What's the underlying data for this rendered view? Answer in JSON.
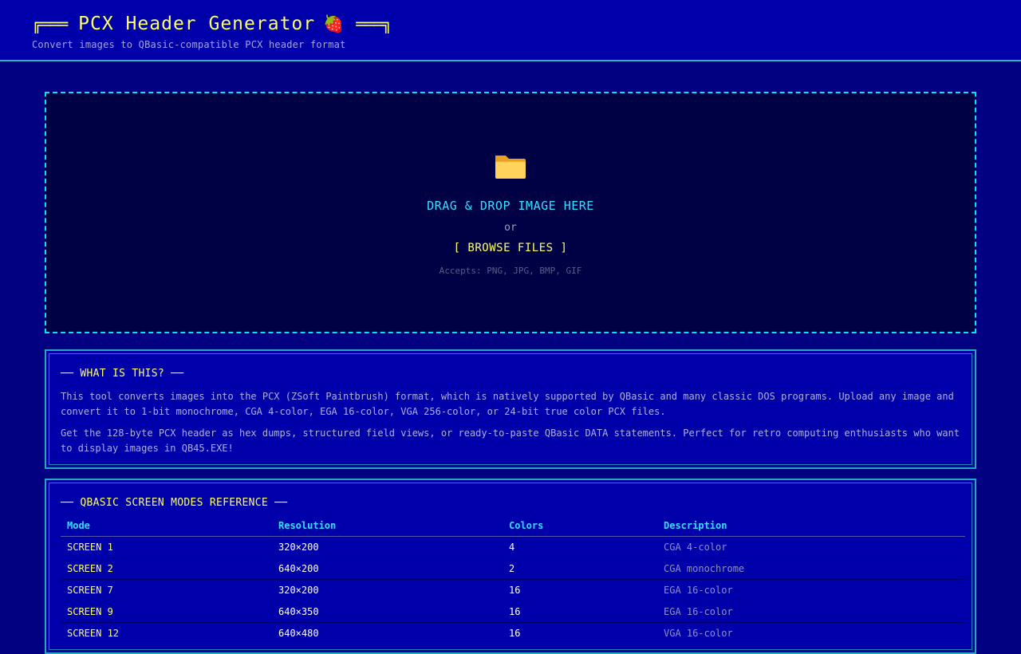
{
  "header": {
    "deco_left": "╔═══",
    "title": "PCX Header Generator",
    "emoji": "🍓",
    "deco_right": "═══╗",
    "subtitle": "Convert images to QBasic-compatible PCX header format"
  },
  "dropzone": {
    "icon": "folder-icon",
    "title": "DRAG & DROP IMAGE HERE",
    "or": "or",
    "browse_label": "[ BROWSE FILES ]",
    "accepts": "Accepts: PNG, JPG, BMP, GIF"
  },
  "about": {
    "title": "── WHAT IS THIS? ──",
    "paragraphs": [
      "This tool converts images into the PCX (ZSoft Paintbrush) format, which is natively supported by QBasic and many classic DOS programs. Upload any image and convert it to 1-bit monochrome, CGA 4-color, EGA 16-color, VGA 256-color, or 24-bit true color PCX files.",
      "Get the 128-byte PCX header as hex dumps, structured field views, or ready-to-paste QBasic DATA statements. Perfect for retro computing enthusiasts who want to display images in QB45.EXE!"
    ]
  },
  "modes": {
    "title": "── QBASIC SCREEN MODES REFERENCE ──",
    "columns": [
      "Mode",
      "Resolution",
      "Colors",
      "Description"
    ],
    "rows": [
      {
        "mode": "SCREEN 1",
        "resolution": "320×200",
        "colors": "4",
        "description": "CGA 4-color"
      },
      {
        "mode": "SCREEN 2",
        "resolution": "640×200",
        "colors": "2",
        "description": "CGA monochrome"
      },
      {
        "mode": "SCREEN 7",
        "resolution": "320×200",
        "colors": "16",
        "description": "EGA 16-color"
      },
      {
        "mode": "SCREEN 9",
        "resolution": "640×350",
        "colors": "16",
        "description": "EGA 16-color"
      },
      {
        "mode": "SCREEN 12",
        "resolution": "640×480",
        "colors": "16",
        "description": "VGA 16-color"
      }
    ]
  },
  "colors": {
    "background": "#000080",
    "header": "#0000aa",
    "accent_cyan": "#00e5ff",
    "accent_yellow": "#ffff66"
  }
}
